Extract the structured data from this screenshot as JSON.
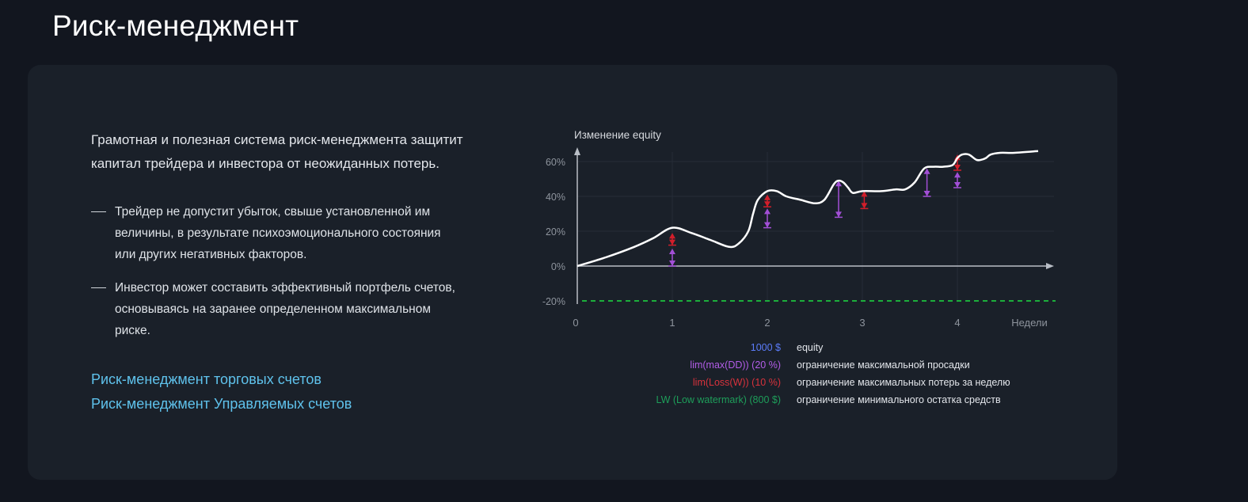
{
  "page": {
    "title": "Риск-менеджмент"
  },
  "content": {
    "lead": "Грамотная и полезная система риск-менеджмента защитит капитал трейдера и инвестора от неожиданных потерь.",
    "bullets": [
      {
        "text": "Трейдер не допустит убыток, свыше установленной им величины, в результате психоэмоционального состояния или других негативных факторов."
      },
      {
        "text": "Инвестор может составить эффективный портфель счетов, основываясь на заранее определенном максимальном риске."
      }
    ],
    "links": [
      {
        "label": "Риск-менеджмент торговых счетов"
      },
      {
        "label": "Риск-менеджмент Управляемых счетов"
      }
    ]
  },
  "chart_data": {
    "type": "line",
    "title": "Изменение equity",
    "xlabel": "Недели",
    "x_ticks": [
      "0",
      "1",
      "2",
      "3",
      "4"
    ],
    "y_ticks": [
      "-20%",
      "0%",
      "20%",
      "40%",
      "60%"
    ],
    "xlim": [
      0,
      5
    ],
    "ylim": [
      -20,
      65
    ],
    "series": [
      {
        "name": "equity",
        "x": [
          0,
          0.3,
          0.6,
          0.8,
          1.0,
          1.2,
          1.4,
          1.6,
          1.7,
          1.8,
          1.85,
          1.9,
          2.0,
          2.1,
          2.2,
          2.35,
          2.5,
          2.6,
          2.7,
          2.75,
          2.8,
          2.85,
          2.9,
          3.0,
          3.2,
          3.35,
          3.45,
          3.55,
          3.65,
          3.75,
          3.85,
          3.95,
          4.0,
          4.05,
          4.12,
          4.2,
          4.25,
          4.3,
          4.35,
          4.45,
          4.6,
          4.85
        ],
        "y": [
          0,
          5,
          11,
          16,
          22,
          19,
          15,
          11,
          13,
          20,
          30,
          38,
          43,
          43,
          40,
          38,
          36,
          38,
          47,
          49,
          48,
          45,
          42,
          43,
          43,
          44,
          44,
          48,
          56,
          57,
          57,
          58,
          62,
          64,
          64,
          61,
          61,
          62,
          64,
          65,
          65,
          66
        ]
      }
    ],
    "drawdown_markers": [
      {
        "x": 1.0,
        "limit": "maxDD",
        "from": 10,
        "to": 0
      },
      {
        "x": 1.0,
        "limit": "lossW",
        "from": 19,
        "to": 12
      },
      {
        "x": 2.0,
        "limit": "maxDD",
        "from": 33,
        "to": 22
      },
      {
        "x": 2.0,
        "limit": "lossW",
        "from": 41,
        "to": 34
      },
      {
        "x": 2.75,
        "limit": "maxDD",
        "from": 49,
        "to": 28
      },
      {
        "x": 3.02,
        "limit": "lossW",
        "from": 43,
        "to": 33
      },
      {
        "x": 3.68,
        "limit": "maxDD",
        "from": 56,
        "to": 40
      },
      {
        "x": 4.0,
        "limit": "maxDD",
        "from": 54,
        "to": 45
      },
      {
        "x": 4.0,
        "limit": "lossW",
        "from": 64,
        "to": 55
      }
    ],
    "low_watermark_y": -20,
    "legend": [
      {
        "key": "1000 $",
        "desc": "equity",
        "color": "#5b7cfa"
      },
      {
        "key": "lim(max(DD)) (20 %)",
        "desc": "ограничение максимальной просадки",
        "color": "#b35de8"
      },
      {
        "key": "lim(Loss(W)) (10 %)",
        "desc": "ограничение максимальных потерь за неделю",
        "color": "#d8323c"
      },
      {
        "key": "LW (Low watermark) (800 $)",
        "desc": "ограничение минимального остатка средств",
        "color": "#1e9e5a"
      }
    ],
    "colors": {
      "equity_line": "#ffffff",
      "maxDD": "#a24fd6",
      "lossW": "#d21e2a",
      "low_watermark": "#1cae3b",
      "axis": "#b9bec6",
      "grid": "#262d38"
    }
  }
}
